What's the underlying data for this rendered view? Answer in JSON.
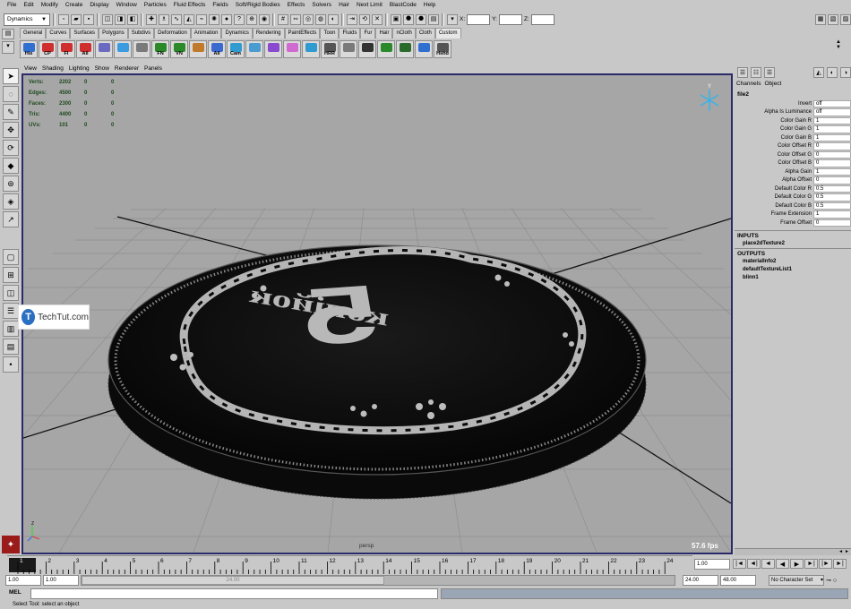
{
  "menubar": [
    "File",
    "Edit",
    "Modify",
    "Create",
    "Display",
    "Window",
    "Particles",
    "Fluid Effects",
    "Fields",
    "Soft/Rigid Bodies",
    "Effects",
    "Solvers",
    "Hair",
    "Next Limit",
    "BlastCode",
    "Help"
  ],
  "status": {
    "menu_set": "Dynamics",
    "x_label": "X:",
    "y_label": "Y:",
    "z_label": "Z:"
  },
  "shelf": {
    "tabs": [
      "General",
      "Curves",
      "Surfaces",
      "Polygons",
      "Subdivs",
      "Deformation",
      "Animation",
      "Dynamics",
      "Rendering",
      "PaintEffects",
      "Toon",
      "Fluids",
      "Fur",
      "Hair",
      "nCloth",
      "Cloth",
      "Custom"
    ],
    "active_tab": "Custom",
    "icons": [
      "His",
      "CP",
      "FI",
      "All",
      "",
      "",
      "",
      "FN",
      "VN",
      "",
      "All",
      "Cam",
      "",
      "",
      "",
      "",
      "HRR",
      "",
      "",
      "",
      "",
      "",
      "Hshd"
    ]
  },
  "viewport": {
    "menu": [
      "View",
      "Shading",
      "Lighting",
      "Show",
      "Renderer",
      "Panels"
    ],
    "hud": [
      {
        "label": "Verts:",
        "v1": "2202",
        "v2": "0",
        "v3": "0"
      },
      {
        "label": "Edges:",
        "v1": "4500",
        "v2": "0",
        "v3": "0"
      },
      {
        "label": "Faces:",
        "v1": "2300",
        "v2": "0",
        "v3": "0"
      },
      {
        "label": "Tris:",
        "v1": "4400",
        "v2": "0",
        "v3": "0"
      },
      {
        "label": "UVs:",
        "v1": "101",
        "v2": "0",
        "v3": "0"
      }
    ],
    "camera": "persp",
    "fps": "57.6 fps",
    "coin_number": "5",
    "coin_word": "копійок",
    "axis_y": "Y",
    "axis_x": "X",
    "axis_z": "Z"
  },
  "watermark": {
    "text": "TechTut.com",
    "logo": "T"
  },
  "channel_box": {
    "menu": [
      "Channels",
      "Object"
    ],
    "object": "file2",
    "attributes": [
      {
        "name": "Invert",
        "value": "off"
      },
      {
        "name": "Alpha Is Luminance",
        "value": "off"
      },
      {
        "name": "Color Gain R",
        "value": "1"
      },
      {
        "name": "Color Gain G",
        "value": "1"
      },
      {
        "name": "Color Gain B",
        "value": "1"
      },
      {
        "name": "Color Offset R",
        "value": "0"
      },
      {
        "name": "Color Offset G",
        "value": "0"
      },
      {
        "name": "Color Offset B",
        "value": "0"
      },
      {
        "name": "Alpha Gain",
        "value": "1"
      },
      {
        "name": "Alpha Offset",
        "value": "0"
      },
      {
        "name": "Default Color R",
        "value": "0.5"
      },
      {
        "name": "Default Color G",
        "value": "0.5"
      },
      {
        "name": "Default Color B",
        "value": "0.5"
      },
      {
        "name": "Frame Extension",
        "value": "1"
      },
      {
        "name": "Frame Offset",
        "value": "0"
      }
    ],
    "inputs_label": "INPUTS",
    "inputs": [
      "place2dTexture2"
    ],
    "outputs_label": "OUTPUTS",
    "outputs": [
      "materialInfo2",
      "defaultTextureList1",
      "blinn1"
    ]
  },
  "timeline": {
    "current_frame": "1",
    "ticks": [
      "1",
      "2",
      "3",
      "4",
      "5",
      "6",
      "7",
      "8",
      "9",
      "10",
      "11",
      "12",
      "13",
      "14",
      "15",
      "16",
      "17",
      "18",
      "19",
      "20",
      "21",
      "22",
      "23",
      "24"
    ],
    "current_time": "1.00"
  },
  "range": {
    "start": "1.00",
    "inner_start": "1.00",
    "thumb": "24.00",
    "end": "24.00",
    "anim_end": "48.00",
    "char_set": "No Character Set"
  },
  "cmdline": {
    "label": "MEL"
  },
  "help": "Select Tool: select an object",
  "colors": {
    "viewport_bg": "#a6a6a6",
    "viewport_border": "#2a2a6b",
    "coin": "#0b0b0b",
    "grid": "#8e8e8e",
    "hud": "#1f4a1f"
  }
}
